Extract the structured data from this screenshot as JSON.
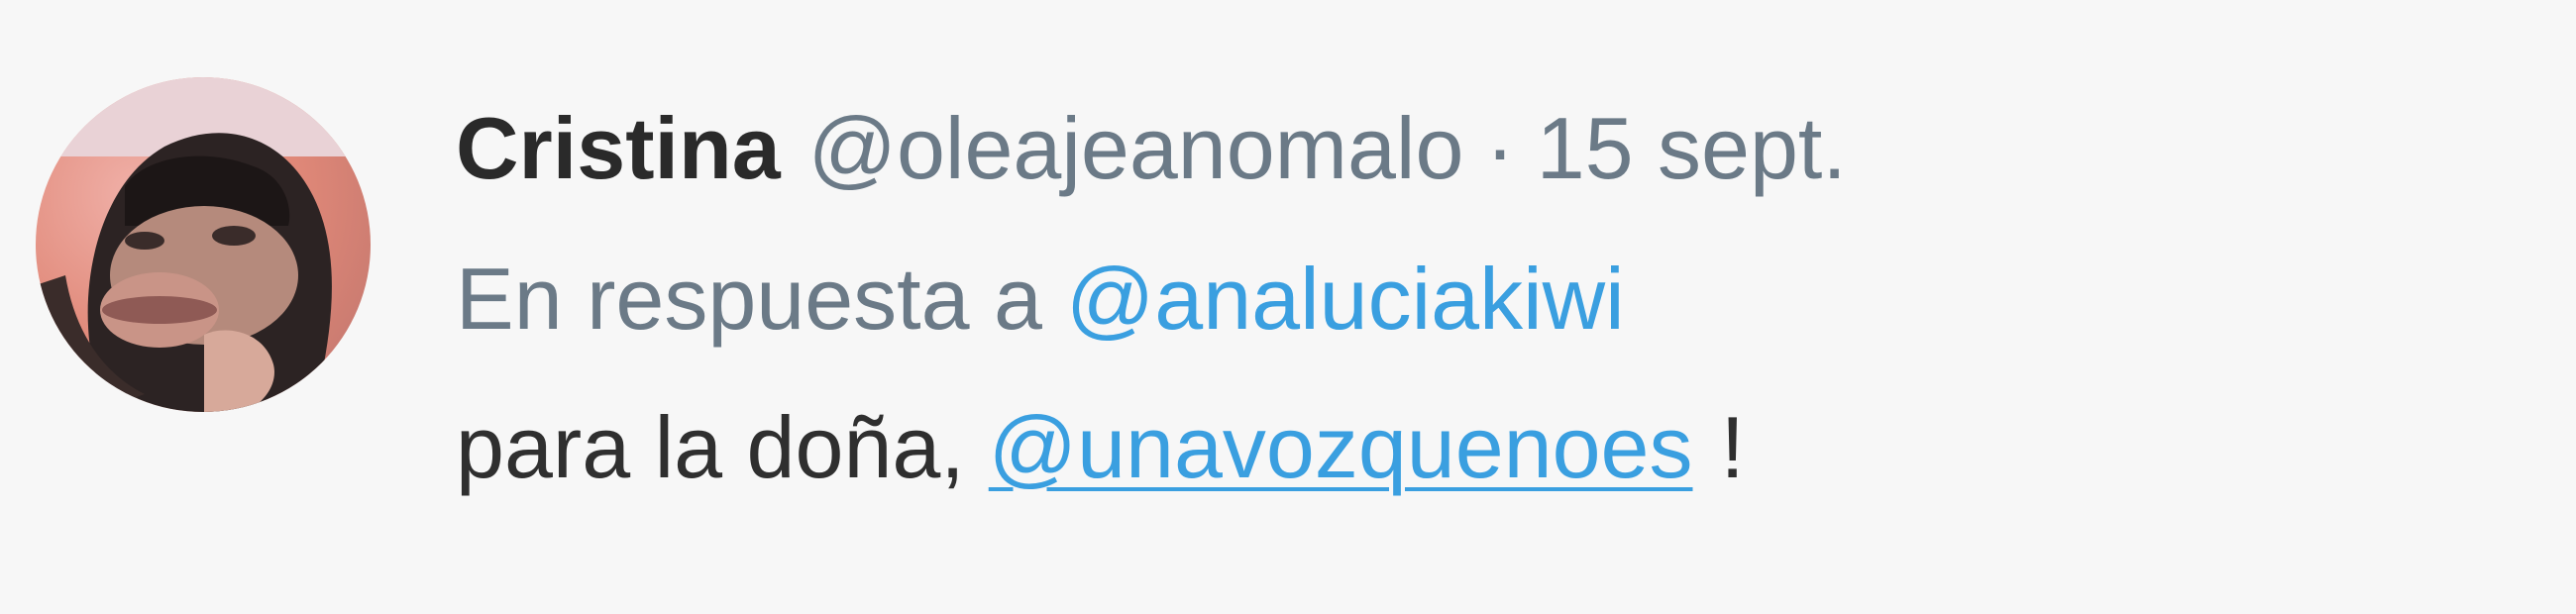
{
  "tweet": {
    "display_name": "Cristina",
    "handle": "@oleajeanomalo",
    "separator": "·",
    "date": "15 sept.",
    "reply_prefix": "En respuesta a",
    "reply_to": "@analuciakiwi",
    "body_text": "para la doña,",
    "body_mention": "@unavozquenoes",
    "body_suffix": "!"
  },
  "colors": {
    "background": "#f7f7f7",
    "link": "#3a9fe0",
    "secondary_text": "#6b7a87",
    "primary_text": "#2a2a2a"
  }
}
